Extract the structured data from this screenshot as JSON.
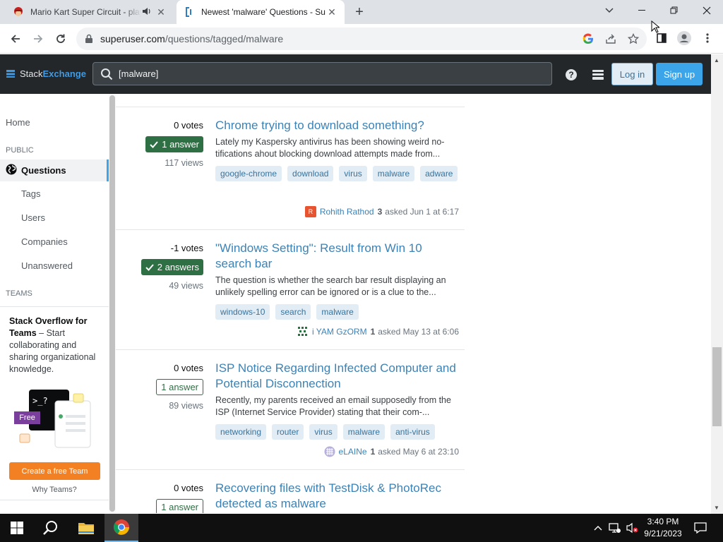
{
  "browser": {
    "tabs": [
      {
        "title": "Mario Kart Super Circuit - play",
        "active": false
      },
      {
        "title": "Newest 'malware' Questions - Su",
        "active": true
      }
    ],
    "url_host": "superuser.com",
    "url_path": "/questions/tagged/malware"
  },
  "site": {
    "logo_stack": "Stack",
    "logo_exchange": "Exchange",
    "search_value": "[malware]",
    "login_label": "Log in",
    "signup_label": "Sign up"
  },
  "sidebar": {
    "home": "Home",
    "public_heading": "PUBLIC",
    "questions": "Questions",
    "items": [
      "Tags",
      "Users",
      "Companies",
      "Unanswered"
    ],
    "teams_heading": "TEAMS",
    "teams_title": "Stack Overflow for Teams",
    "teams_text": " – Start collaborating and sharing organizational knowledge.",
    "free_badge": "Free",
    "create_team": "Create a free Team",
    "why_teams": "Why Teams?"
  },
  "questions": [
    {
      "votes": "0 votes",
      "answers": "1 answer",
      "accepted": true,
      "views": "117 views",
      "title": "Chrome trying to download something?",
      "excerpt": "Lately my Kaspersky antivirus has been showing weird no-tifications ahout blocking download attempts made from...",
      "tags": [
        "google-chrome",
        "download",
        "virus",
        "malware",
        "adware"
      ],
      "user": "Rohith Rathod",
      "rep": "3",
      "asked": "asked Jun 1 at 6:17",
      "avatar_color": "#e8542f",
      "avatar_letter": "R"
    },
    {
      "votes": "-1 votes",
      "answers": "2 answers",
      "accepted": true,
      "views": "49 views",
      "title": "\"Windows Setting\": Result from Win 10 search bar",
      "excerpt": "The question is whether the search bar result displaying an unlikely spelling error can be ignored or is a clue to the...",
      "tags": [
        "windows-10",
        "search",
        "malware"
      ],
      "user": "i YAM GzORM",
      "rep": "1",
      "asked": "asked May 13 at 6:06",
      "avatar_color": "#2f6f44",
      "avatar_letter": ""
    },
    {
      "votes": "0 votes",
      "answers": "1 answer",
      "accepted": false,
      "views": "89 views",
      "title": "ISP Notice Regarding Infected Computer and Potential Disconnection",
      "excerpt": "Recently, my parents received an email supposedly from the ISP (Internet Service Provider) stating that their com-...",
      "tags": [
        "networking",
        "router",
        "virus",
        "malware",
        "anti-virus"
      ],
      "user": "eLAINe",
      "rep": "1",
      "asked": "asked May 6 at 23:10",
      "avatar_color": "#9a8fc8",
      "avatar_letter": ""
    },
    {
      "votes": "0 votes",
      "answers": "1 answer",
      "accepted": false,
      "views": "",
      "title": "Recovering files with TestDisk & PhotoRec detected as malware",
      "excerpt": "",
      "tags": [],
      "user": "",
      "rep": "",
      "asked": "",
      "avatar_color": "",
      "avatar_letter": ""
    }
  ],
  "taskbar": {
    "time": "3:40 PM",
    "date": "9/21/2023"
  },
  "colors": {
    "accepted_green": "#2f6f44",
    "link_blue": "#3d82b5",
    "tag_bg": "#e1ecf4",
    "orange": "#f48024"
  }
}
